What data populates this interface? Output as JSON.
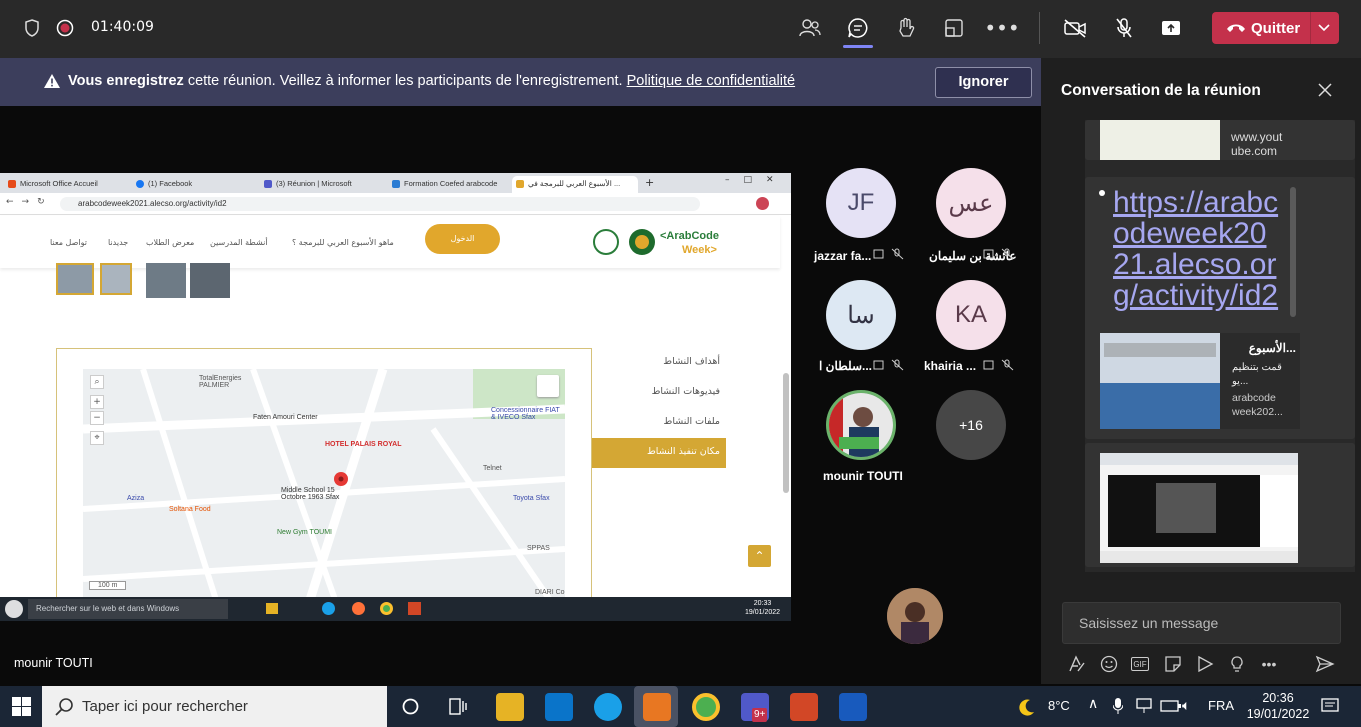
{
  "topbar": {
    "timer": "01:40:09",
    "leave_label": "Quitter",
    "accent": "#c4314b"
  },
  "banner": {
    "bold": "Vous enregistrez",
    "text": "Vous enregistrez cette réunion. Veillez à informer les participants de l'enregistrement.",
    "link": "Politique de confidentialité",
    "ignore_label": "Ignorer"
  },
  "shared": {
    "presenter": "mounir TOUTI",
    "tabs": [
      "Microsoft Office Accueil",
      "(1) Facebook",
      "(3) Réunion | Microsoft",
      "Formation Coefed arabcode",
      "الأسبوع العربي للبرمجة في ..."
    ],
    "url": "arabcodeweek2021.alecso.org/activity/id2",
    "nav": [
      "تواصل معنا",
      "جديدنا",
      "معرض الطلاب",
      "أنشطة المدرسين",
      "ماهو الأسبوع العربي للبرمجة ؟"
    ],
    "login_label": "الدخول",
    "logo_text": "<ArabCode Week>",
    "side_menu": [
      "أهداف النشاط",
      "فيديوهات النشاط",
      "ملفات النشاط",
      "مكان تنفيذ النشاط"
    ],
    "map_labels": {
      "hotel": "HOTEL PALAIS ROYAL",
      "school": "Middle School 15 Octobre 1963 Sfax",
      "faten": "Faten Amouri Center",
      "total": "TotalEnergies PALMIER",
      "fiat": "Concessionnaire FIAT & IVECO Sfax",
      "toyota": "Toyota Sfax",
      "soltana": "Soltana Food",
      "gym": "New Gym TOUMI",
      "telnet": "Telnet",
      "spas": "SPPAS",
      "aziza": "Aziza",
      "diari": "DIARI Co",
      "scale": "100 m"
    },
    "win_search": "Rechercher sur le web et dans Windows",
    "win_time": "20:33",
    "win_date": "19/01/2022"
  },
  "participants": [
    {
      "initials": "JF",
      "name": "jazzar fa...",
      "bg": "#e5e2f5",
      "fg": "#4a4a6a"
    },
    {
      "initials": "عس",
      "name": "عائشة بن سليمان",
      "bg": "#f5e0ea",
      "fg": "#5a3a4a"
    },
    {
      "initials": "سا",
      "name": "سلطان ا...",
      "bg": "#dde8f3",
      "fg": "#334"
    },
    {
      "initials": "KA",
      "name": "khairia ...",
      "bg": "#f5e0ea",
      "fg": "#5a3a4a"
    },
    {
      "initials": "",
      "name": "mounir TOUTI",
      "bg": "#2e7d32",
      "fg": "#fff"
    },
    {
      "initials": "+16",
      "name": "",
      "bg": "#474747",
      "fg": "#fff"
    }
  ],
  "chat": {
    "title": "Conversation de la réunion",
    "card1_text": "www.yout ube.com",
    "link": "https://arabcodeweek2021.alecso.org/activity/id2",
    "preview_title": "الأسبوع...",
    "preview_desc": "قمت بتنظيم يو...",
    "preview_domain": "arabcode week202...",
    "input_placeholder": "Saisissez un message"
  },
  "taskbar": {
    "search_placeholder": "Taper ici pour rechercher",
    "temp": "8°C",
    "lang": "FRA",
    "time": "20:36",
    "date": "19/01/2022",
    "teams_badge": "9+"
  }
}
